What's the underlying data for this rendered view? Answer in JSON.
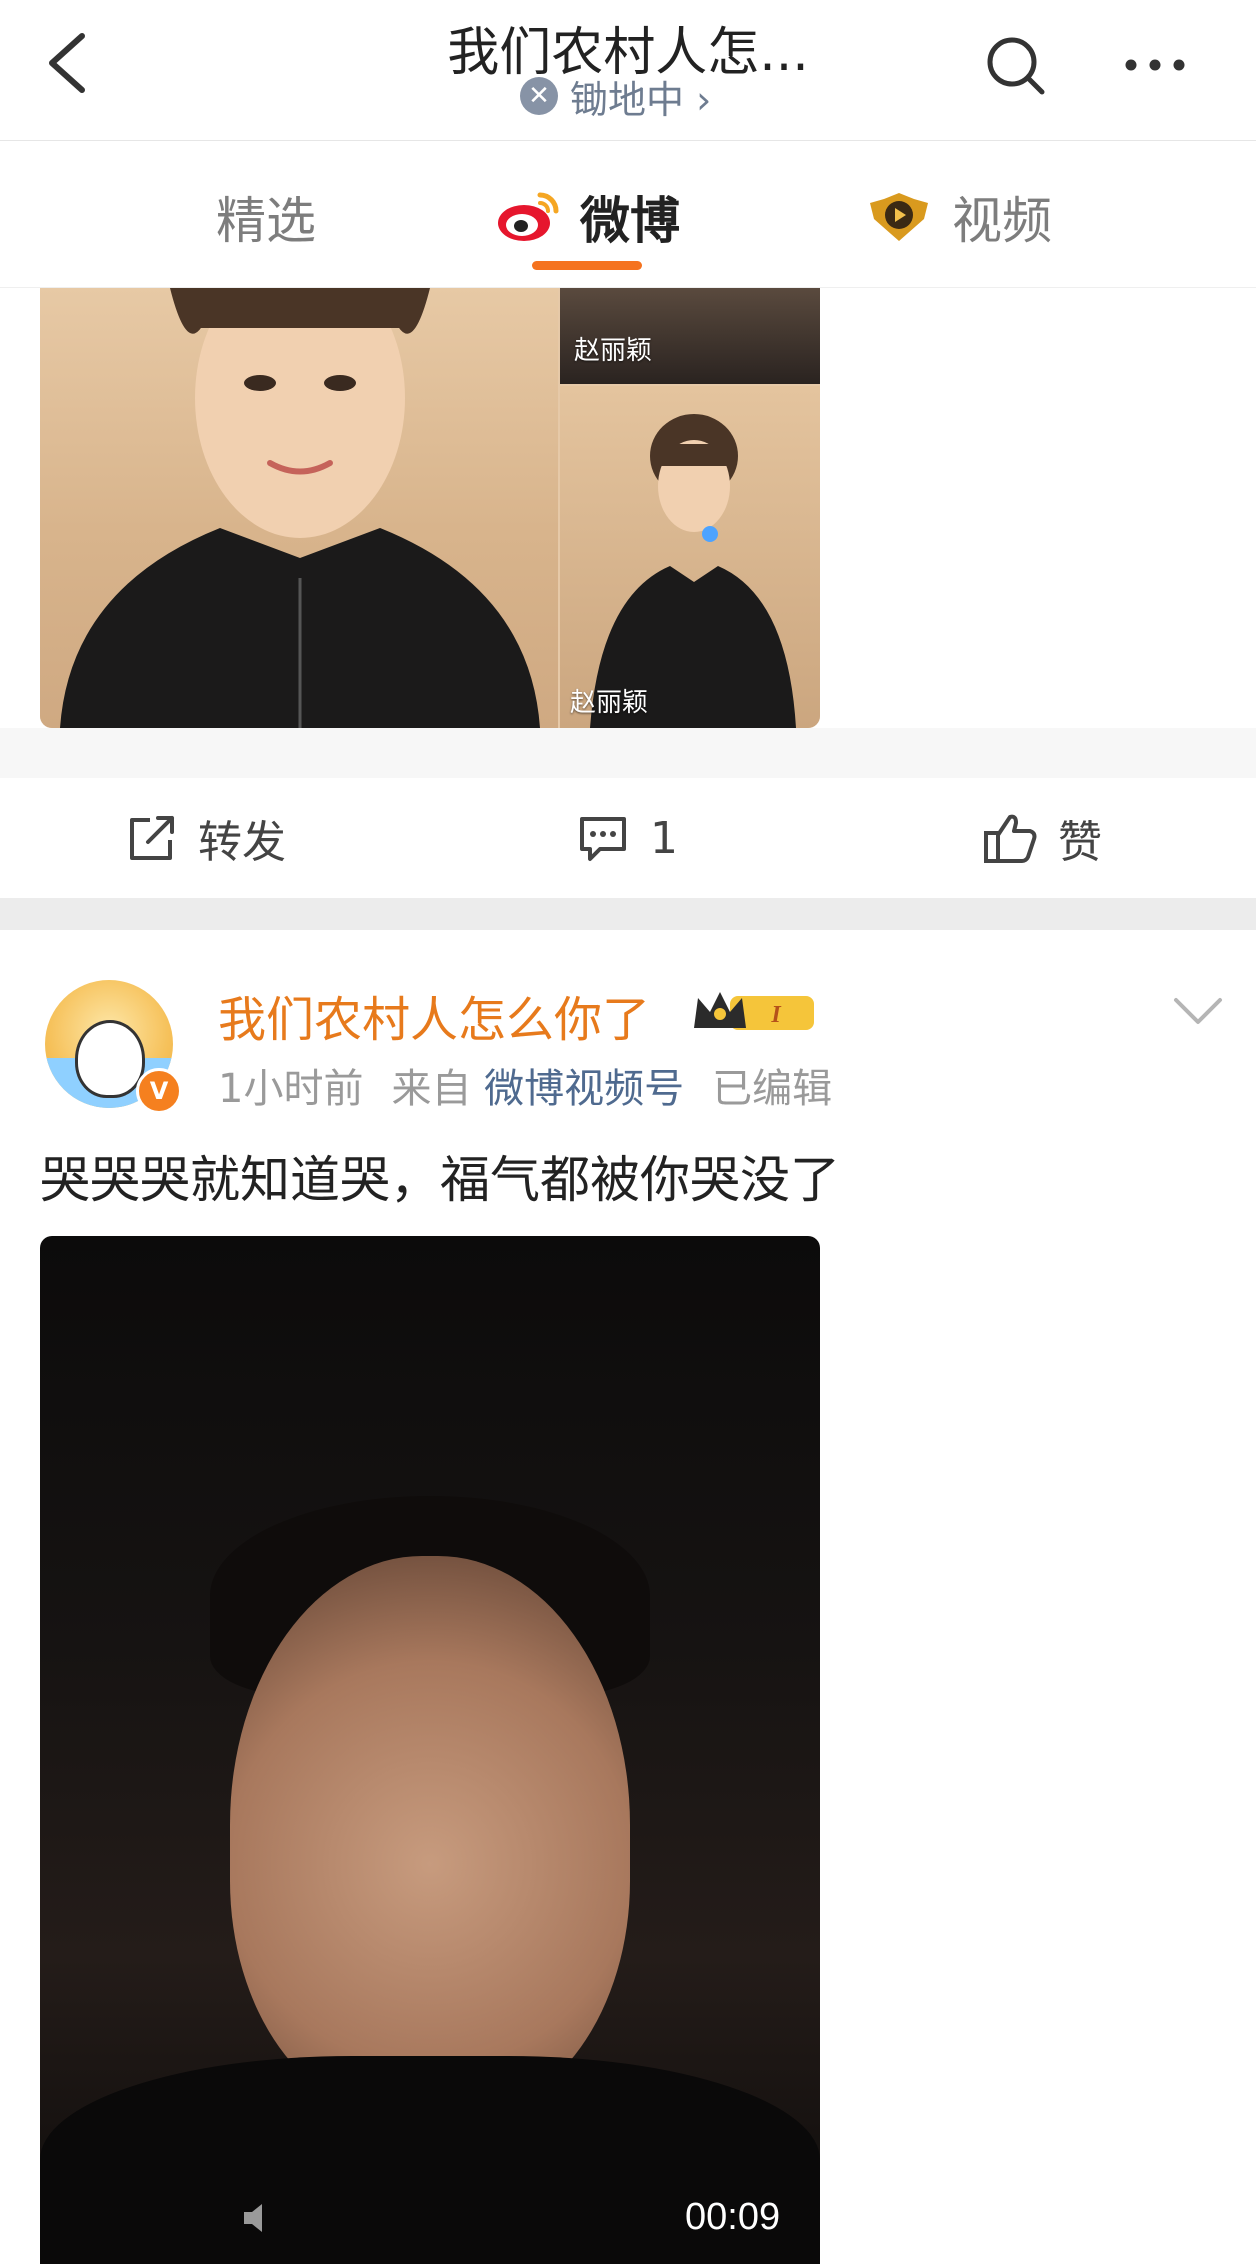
{
  "header": {
    "title": "我们农村人怎...",
    "subtitle": "锄地中 ›"
  },
  "tabs": [
    {
      "label": "精选"
    },
    {
      "label": "微博"
    },
    {
      "label": "视频"
    }
  ],
  "media1": {
    "captions": [
      "赵丽颖",
      "赵丽颖"
    ]
  },
  "actions": {
    "repost": "转发",
    "comment_count": "1",
    "like": "赞"
  },
  "post": {
    "author": "我们农村人怎么你了",
    "level_badge": "I",
    "time": "1小时前",
    "from_label": "来自",
    "source": "微博视频号",
    "edited": "已编辑",
    "text": "哭哭哭就知道哭，福气都被你哭没了",
    "video_duration": "00:09"
  },
  "colors": {
    "accent": "#f5731f",
    "username": "#e77a1c",
    "source_link": "#4f6a8f"
  }
}
